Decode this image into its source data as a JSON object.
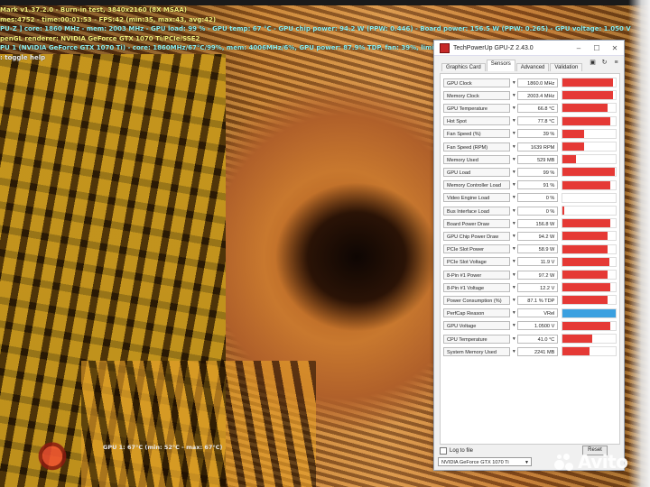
{
  "osd": {
    "lines": [
      {
        "text": "Mark v1.37.2.0 - Burn-in test, 3840x2160 (8X MSAA)",
        "color": "l-yellow"
      },
      {
        "text": "mes:4752 - time:00:01:53 - FPS:42 (min:35, max:43, avg:42)",
        "color": "l-yellow"
      },
      {
        "text": "PU-Z ] core: 1860 MHz - mem: 2003 MHz - GPU load: 99 % - GPU temp: 67 °C - GPU chip power: 94.2 W (PPW: 0.446) - Board power: 156.5 W (PPW: 0.265) - GPU voltage: 1.050 V",
        "color": "l-cyan"
      },
      {
        "text": "penGL renderer: NVIDIA GeForce GTX 1070 Ti/PCIe/SSE2",
        "color": "l-yellow"
      },
      {
        "text": "PU 1 (NVIDIA GeForce GTX 1070 Ti) - core: 1860MHz/67°C/99%, mem: 4006MHz/6%, GPU power: 87.9% TDP, fan: 39%, limited[power:0, temp:0, volt:1, OV:0]",
        "color": "l-cyan"
      },
      {
        "text": ": toggle help",
        "color": "l-white"
      }
    ],
    "gpu_temp_text": "GPU 1: 67°C (min: 52°C - max: 67°C)"
  },
  "gpuz": {
    "title": "TechPowerUp GPU-Z 2.43.0",
    "tabs": [
      "Graphics Card",
      "Sensors",
      "Advanced",
      "Validation"
    ],
    "active_tab": "Sensors",
    "sensors": [
      {
        "label": "GPU Clock",
        "value": "1860.0 MHz",
        "level": 0.95,
        "color": "#e53935"
      },
      {
        "label": "Memory Clock",
        "value": "2003.4 MHz",
        "level": 0.95,
        "color": "#e53935"
      },
      {
        "label": "GPU Temperature",
        "value": "66.8 °C",
        "level": 0.85,
        "color": "#e53935"
      },
      {
        "label": "Hot Spot",
        "value": "77.8 °C",
        "level": 0.9,
        "color": "#e53935"
      },
      {
        "label": "Fan Speed (%)",
        "value": "39 %",
        "level": 0.4,
        "color": "#e53935"
      },
      {
        "label": "Fan Speed (RPM)",
        "value": "1639 RPM",
        "level": 0.4,
        "color": "#e53935"
      },
      {
        "label": "Memory Used",
        "value": "529 MB",
        "level": 0.25,
        "color": "#e53935"
      },
      {
        "label": "GPU Load",
        "value": "99 %",
        "level": 0.98,
        "color": "#e53935"
      },
      {
        "label": "Memory Controller Load",
        "value": "91 %",
        "level": 0.9,
        "color": "#e53935"
      },
      {
        "label": "Video Engine Load",
        "value": "0 %",
        "level": 0.0,
        "color": "#e53935"
      },
      {
        "label": "Bus Interface Load",
        "value": "0 %",
        "level": 0.02,
        "color": "#e53935"
      },
      {
        "label": "Board Power Draw",
        "value": "156.8 W",
        "level": 0.9,
        "color": "#e53935"
      },
      {
        "label": "GPU Chip Power Draw",
        "value": "94.2 W",
        "level": 0.85,
        "color": "#e53935"
      },
      {
        "label": "PCIe Slot Power",
        "value": "58.9 W",
        "level": 0.85,
        "color": "#e53935"
      },
      {
        "label": "PCIe Slot Voltage",
        "value": "11.9 V",
        "level": 0.88,
        "color": "#e53935"
      },
      {
        "label": "8-Pin #1 Power",
        "value": "97.2 W",
        "level": 0.85,
        "color": "#e53935"
      },
      {
        "label": "8-Pin #1 Voltage",
        "value": "12.2 V",
        "level": 0.9,
        "color": "#e53935"
      },
      {
        "label": "Power Consumption (%)",
        "value": "87.1 % TDP",
        "level": 0.85,
        "color": "#e53935"
      },
      {
        "label": "PerfCap Reason",
        "value": "VRel",
        "level": 1.0,
        "color": "#3aa0e0"
      },
      {
        "label": "GPU Voltage",
        "value": "1.0500 V",
        "level": 0.9,
        "color": "#e53935"
      },
      {
        "label": "CPU Temperature",
        "value": "41.0 °C",
        "level": 0.55,
        "color": "#e53935"
      },
      {
        "label": "System Memory Used",
        "value": "2241 MB",
        "level": 0.5,
        "color": "#e53935"
      }
    ],
    "log_to_file": "Log to file",
    "reset_label": "Reset",
    "gpu_select": "NVIDIA GeForce GTX 1070 Ti"
  },
  "watermark": "Avito"
}
